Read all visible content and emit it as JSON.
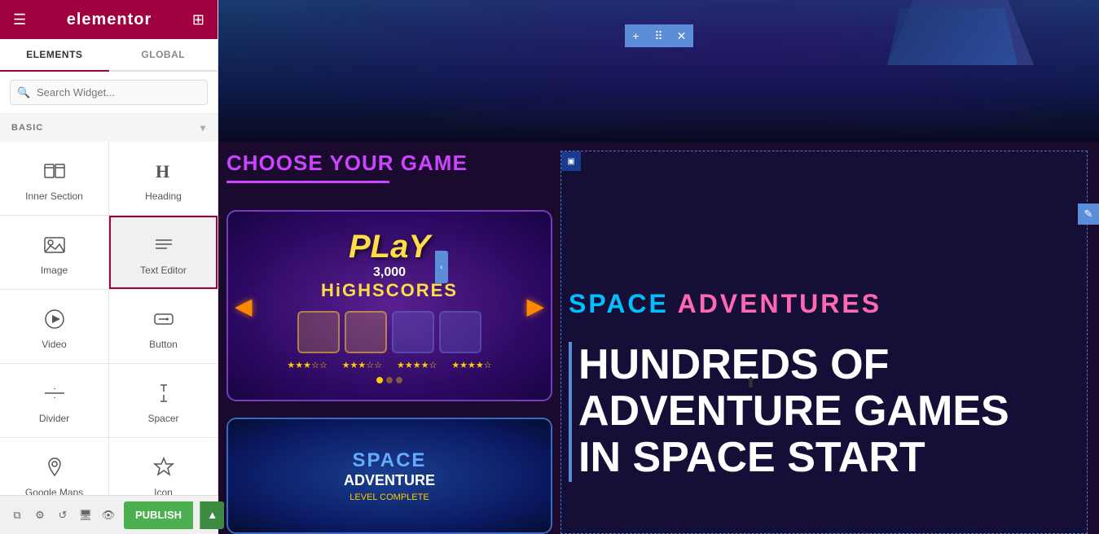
{
  "sidebar": {
    "logo": "elementor",
    "tabs": [
      {
        "id": "elements",
        "label": "ELEMENTS",
        "active": true
      },
      {
        "id": "global",
        "label": "GLOBAL",
        "active": false
      }
    ],
    "search": {
      "placeholder": "Search Widget..."
    },
    "section_label": "BASIC",
    "widgets": [
      {
        "id": "inner-section",
        "label": "Inner Section",
        "icon": "inner-section-icon"
      },
      {
        "id": "heading",
        "label": "Heading",
        "icon": "heading-icon"
      },
      {
        "id": "image",
        "label": "Image",
        "icon": "image-icon"
      },
      {
        "id": "text-editor",
        "label": "Text Editor",
        "icon": "text-editor-icon"
      },
      {
        "id": "video",
        "label": "Video",
        "icon": "video-icon"
      },
      {
        "id": "button",
        "label": "Button",
        "icon": "button-icon"
      },
      {
        "id": "divider",
        "label": "Divider",
        "icon": "divider-icon"
      },
      {
        "id": "spacer",
        "label": "Spacer",
        "icon": "spacer-icon"
      },
      {
        "id": "google-maps",
        "label": "Google Maps",
        "icon": "google-maps-icon"
      },
      {
        "id": "icon",
        "label": "Icon",
        "icon": "icon-icon"
      }
    ],
    "bottom_icons": [
      "layers-icon",
      "settings-icon",
      "history-icon",
      "responsive-icon",
      "eye-icon"
    ],
    "publish_label": "PUBLISH"
  },
  "toolbar": {
    "add_label": "+",
    "move_label": "⠿",
    "close_label": "✕"
  },
  "main": {
    "choose_heading": "CHOOSE YOUR GAME",
    "space_text": "SPACE",
    "adventures_text": "ADVENTURES",
    "big_heading_line1": "HUNDREDS OF",
    "big_heading_line2": "ADVENTURE GAMES",
    "big_heading_line3": "IN SPACE START",
    "game_card_play_text": "PLaY",
    "game_card_play_sub": "3,000",
    "game_card_play_score": "HIGHSCORES",
    "game_card_space_text": "SPACE",
    "game_card_space_sub": "ADVENTURE",
    "panel_icon": "▣",
    "edit_icon": "✎",
    "collapse_icon": "‹"
  },
  "colors": {
    "sidebar_header_bg": "#a1003e",
    "accent_purple": "#cc44ff",
    "accent_cyan": "#00bfff",
    "accent_pink": "#ff69b4",
    "toolbar_blue": "#5b8dd9",
    "publish_green": "#4caf50",
    "text_white": "#ffffff",
    "dark_bg": "#1a0a2e"
  }
}
